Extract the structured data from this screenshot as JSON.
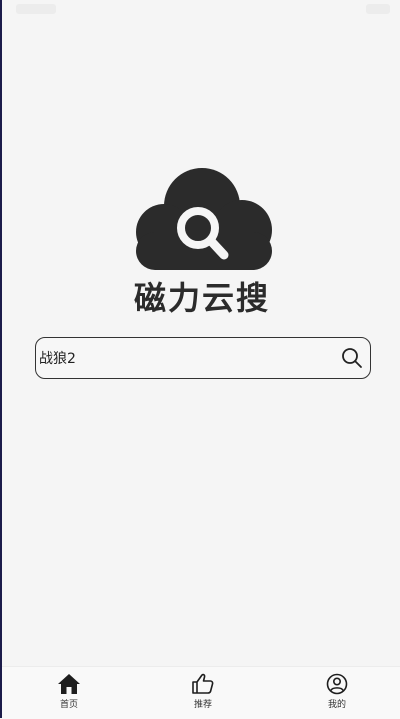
{
  "app": {
    "name": "磁力云搜"
  },
  "search": {
    "value": "战狼2",
    "placeholder": ""
  },
  "tabs": [
    {
      "label": "首页",
      "icon": "home-icon",
      "active": true
    },
    {
      "label": "推荐",
      "icon": "thumbs-up-icon",
      "active": false
    },
    {
      "label": "我的",
      "icon": "user-circle-icon",
      "active": false
    }
  ],
  "colors": {
    "logo": "#2b2b2b",
    "background": "#f5f5f5",
    "border": "#333333"
  }
}
